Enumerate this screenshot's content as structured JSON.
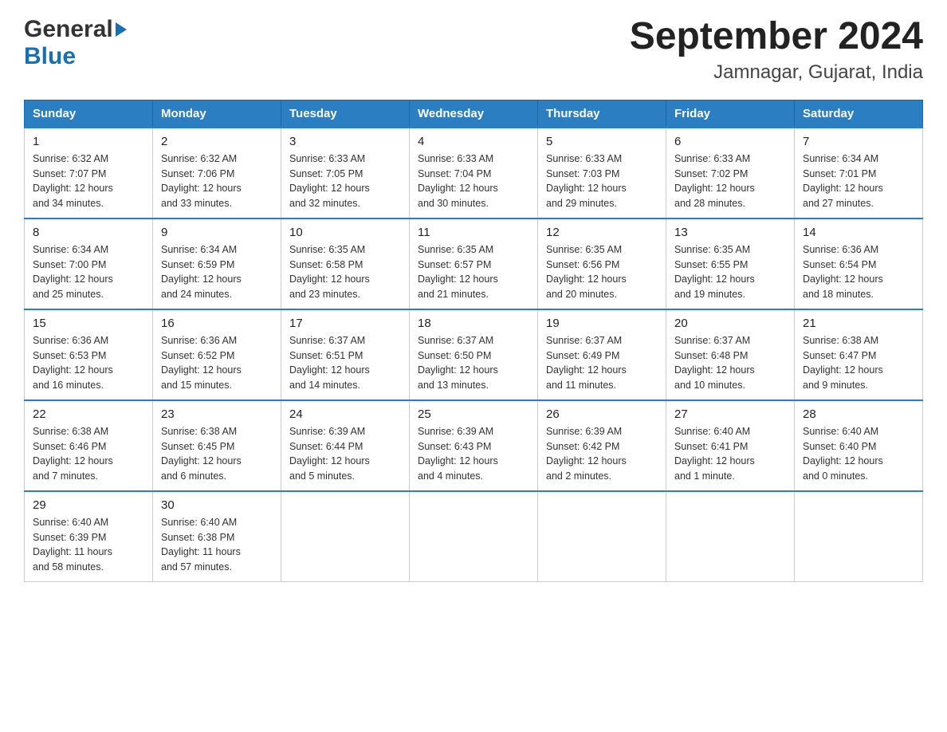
{
  "header": {
    "title": "September 2024",
    "location": "Jamnagar, Gujarat, India",
    "logo_general": "General",
    "logo_blue": "Blue"
  },
  "days_of_week": [
    "Sunday",
    "Monday",
    "Tuesday",
    "Wednesday",
    "Thursday",
    "Friday",
    "Saturday"
  ],
  "weeks": [
    [
      {
        "num": "1",
        "sunrise": "6:32 AM",
        "sunset": "7:07 PM",
        "daylight": "12 hours and 34 minutes."
      },
      {
        "num": "2",
        "sunrise": "6:32 AM",
        "sunset": "7:06 PM",
        "daylight": "12 hours and 33 minutes."
      },
      {
        "num": "3",
        "sunrise": "6:33 AM",
        "sunset": "7:05 PM",
        "daylight": "12 hours and 32 minutes."
      },
      {
        "num": "4",
        "sunrise": "6:33 AM",
        "sunset": "7:04 PM",
        "daylight": "12 hours and 30 minutes."
      },
      {
        "num": "5",
        "sunrise": "6:33 AM",
        "sunset": "7:03 PM",
        "daylight": "12 hours and 29 minutes."
      },
      {
        "num": "6",
        "sunrise": "6:33 AM",
        "sunset": "7:02 PM",
        "daylight": "12 hours and 28 minutes."
      },
      {
        "num": "7",
        "sunrise": "6:34 AM",
        "sunset": "7:01 PM",
        "daylight": "12 hours and 27 minutes."
      }
    ],
    [
      {
        "num": "8",
        "sunrise": "6:34 AM",
        "sunset": "7:00 PM",
        "daylight": "12 hours and 25 minutes."
      },
      {
        "num": "9",
        "sunrise": "6:34 AM",
        "sunset": "6:59 PM",
        "daylight": "12 hours and 24 minutes."
      },
      {
        "num": "10",
        "sunrise": "6:35 AM",
        "sunset": "6:58 PM",
        "daylight": "12 hours and 23 minutes."
      },
      {
        "num": "11",
        "sunrise": "6:35 AM",
        "sunset": "6:57 PM",
        "daylight": "12 hours and 21 minutes."
      },
      {
        "num": "12",
        "sunrise": "6:35 AM",
        "sunset": "6:56 PM",
        "daylight": "12 hours and 20 minutes."
      },
      {
        "num": "13",
        "sunrise": "6:35 AM",
        "sunset": "6:55 PM",
        "daylight": "12 hours and 19 minutes."
      },
      {
        "num": "14",
        "sunrise": "6:36 AM",
        "sunset": "6:54 PM",
        "daylight": "12 hours and 18 minutes."
      }
    ],
    [
      {
        "num": "15",
        "sunrise": "6:36 AM",
        "sunset": "6:53 PM",
        "daylight": "12 hours and 16 minutes."
      },
      {
        "num": "16",
        "sunrise": "6:36 AM",
        "sunset": "6:52 PM",
        "daylight": "12 hours and 15 minutes."
      },
      {
        "num": "17",
        "sunrise": "6:37 AM",
        "sunset": "6:51 PM",
        "daylight": "12 hours and 14 minutes."
      },
      {
        "num": "18",
        "sunrise": "6:37 AM",
        "sunset": "6:50 PM",
        "daylight": "12 hours and 13 minutes."
      },
      {
        "num": "19",
        "sunrise": "6:37 AM",
        "sunset": "6:49 PM",
        "daylight": "12 hours and 11 minutes."
      },
      {
        "num": "20",
        "sunrise": "6:37 AM",
        "sunset": "6:48 PM",
        "daylight": "12 hours and 10 minutes."
      },
      {
        "num": "21",
        "sunrise": "6:38 AM",
        "sunset": "6:47 PM",
        "daylight": "12 hours and 9 minutes."
      }
    ],
    [
      {
        "num": "22",
        "sunrise": "6:38 AM",
        "sunset": "6:46 PM",
        "daylight": "12 hours and 7 minutes."
      },
      {
        "num": "23",
        "sunrise": "6:38 AM",
        "sunset": "6:45 PM",
        "daylight": "12 hours and 6 minutes."
      },
      {
        "num": "24",
        "sunrise": "6:39 AM",
        "sunset": "6:44 PM",
        "daylight": "12 hours and 5 minutes."
      },
      {
        "num": "25",
        "sunrise": "6:39 AM",
        "sunset": "6:43 PM",
        "daylight": "12 hours and 4 minutes."
      },
      {
        "num": "26",
        "sunrise": "6:39 AM",
        "sunset": "6:42 PM",
        "daylight": "12 hours and 2 minutes."
      },
      {
        "num": "27",
        "sunrise": "6:40 AM",
        "sunset": "6:41 PM",
        "daylight": "12 hours and 1 minute."
      },
      {
        "num": "28",
        "sunrise": "6:40 AM",
        "sunset": "6:40 PM",
        "daylight": "12 hours and 0 minutes."
      }
    ],
    [
      {
        "num": "29",
        "sunrise": "6:40 AM",
        "sunset": "6:39 PM",
        "daylight": "11 hours and 58 minutes."
      },
      {
        "num": "30",
        "sunrise": "6:40 AM",
        "sunset": "6:38 PM",
        "daylight": "11 hours and 57 minutes."
      },
      null,
      null,
      null,
      null,
      null
    ]
  ],
  "labels": {
    "sunrise": "Sunrise:",
    "sunset": "Sunset:",
    "daylight": "Daylight:"
  }
}
